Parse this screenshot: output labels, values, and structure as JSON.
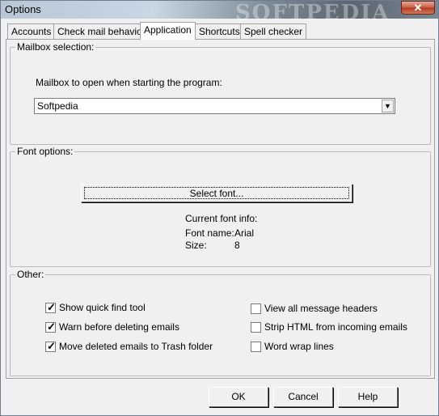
{
  "window": {
    "title": "Options",
    "watermark": "SOFTPEDIA",
    "close_glyph": "✕"
  },
  "tabs": [
    {
      "label": "Accounts"
    },
    {
      "label": "Check mail behavior"
    },
    {
      "label": "Application"
    },
    {
      "label": "Shortcuts"
    },
    {
      "label": "Spell checker"
    }
  ],
  "mailbox": {
    "group_title": "Mailbox selection:",
    "prompt": "Mailbox to open when starting the program:",
    "selected": "Softpedia",
    "arrow_glyph": "▼"
  },
  "font": {
    "group_title": "Font options:",
    "select_button": "Select font...",
    "info_title": "Current font info:",
    "name_label": "Font name:",
    "name_value": "Arial",
    "size_label": "Size:",
    "size_value": "8"
  },
  "other": {
    "group_title": "Other:",
    "options_left": [
      {
        "label": "Show quick find tool",
        "checked": true
      },
      {
        "label": "Warn before deleting emails",
        "checked": true
      },
      {
        "label": "Move deleted emails to Trash folder",
        "checked": true
      }
    ],
    "options_right": [
      {
        "label": "View all message headers",
        "checked": false
      },
      {
        "label": "Strip HTML from incoming emails",
        "checked": false
      },
      {
        "label": "Word wrap lines",
        "checked": false
      }
    ],
    "check_glyph": "✓"
  },
  "buttons": {
    "ok": "OK",
    "cancel": "Cancel",
    "help": "Help"
  }
}
